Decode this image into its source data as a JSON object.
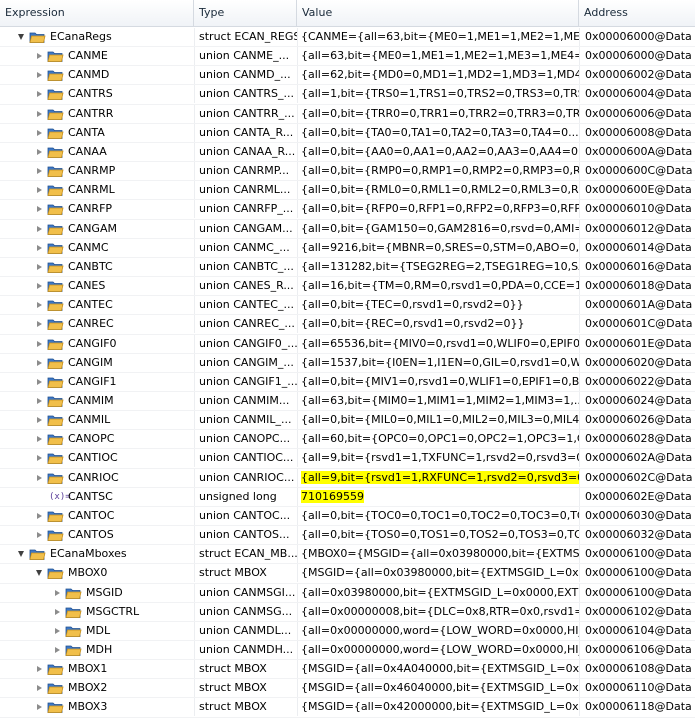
{
  "columns": {
    "expression": "Expression",
    "type": "Type",
    "value": "Value",
    "address": "Address"
  },
  "icons": {
    "struct": "struct-folder-icon",
    "variable": "variable-x-icon"
  },
  "colors": {
    "highlight": "#ffff00",
    "folder_blue": "#3c78c8",
    "folder_yellow": "#f1bf4a"
  },
  "rows": [
    {
      "level": 0,
      "tw": "expanded",
      "icon": "struct",
      "name": "ECanaRegs",
      "type": "struct ECAN_REGS",
      "value": "{CANME={all=63,bit={ME0=1,ME1=1,ME2=1,ME3...",
      "addr": "0x00006000@Data"
    },
    {
      "level": 1,
      "tw": "collapsed",
      "icon": "struct",
      "name": "CANME",
      "type": "union CANME_...",
      "value": "{all=63,bit={ME0=1,ME1=1,ME2=1,ME3=1,ME4=1...",
      "addr": "0x00006000@Data"
    },
    {
      "level": 1,
      "tw": "collapsed",
      "icon": "struct",
      "name": "CANMD",
      "type": "union CANMD_...",
      "value": "{all=62,bit={MD0=0,MD1=1,MD2=1,MD3=1,MD4=...",
      "addr": "0x00006002@Data"
    },
    {
      "level": 1,
      "tw": "collapsed",
      "icon": "struct",
      "name": "CANTRS",
      "type": "union CANTRS_...",
      "value": "{all=1,bit={TRS0=1,TRS1=0,TRS2=0,TRS3=0,TRS4=...",
      "addr": "0x00006004@Data"
    },
    {
      "level": 1,
      "tw": "collapsed",
      "icon": "struct",
      "name": "CANTRR",
      "type": "union CANTRR_...",
      "value": "{all=0,bit={TRR0=0,TRR1=0,TRR2=0,TRR3=0,TRR4...",
      "addr": "0x00006006@Data"
    },
    {
      "level": 1,
      "tw": "collapsed",
      "icon": "struct",
      "name": "CANTA",
      "type": "union CANTA_R...",
      "value": "{all=0,bit={TA0=0,TA1=0,TA2=0,TA3=0,TA4=0...}}",
      "addr": "0x00006008@Data"
    },
    {
      "level": 1,
      "tw": "collapsed",
      "icon": "struct",
      "name": "CANAA",
      "type": "union CANAA_R...",
      "value": "{all=0,bit={AA0=0,AA1=0,AA2=0,AA3=0,AA4=0...}}",
      "addr": "0x0000600A@Data"
    },
    {
      "level": 1,
      "tw": "collapsed",
      "icon": "struct",
      "name": "CANRMP",
      "type": "union CANRMP...",
      "value": "{all=0,bit={RMP0=0,RMP1=0,RMP2=0,RMP3=0,R...",
      "addr": "0x0000600C@Data"
    },
    {
      "level": 1,
      "tw": "collapsed",
      "icon": "struct",
      "name": "CANRML",
      "type": "union CANRML...",
      "value": "{all=0,bit={RML0=0,RML1=0,RML2=0,RML3=0,RM...",
      "addr": "0x0000600E@Data"
    },
    {
      "level": 1,
      "tw": "collapsed",
      "icon": "struct",
      "name": "CANRFP",
      "type": "union CANRFP_...",
      "value": "{all=0,bit={RFP0=0,RFP1=0,RFP2=0,RFP3=0,RFP4...",
      "addr": "0x00006010@Data"
    },
    {
      "level": 1,
      "tw": "collapsed",
      "icon": "struct",
      "name": "CANGAM",
      "type": "union CANGAM...",
      "value": "{all=0,bit={GAM150=0,GAM2816=0,rsvd=0,AMI=0}}",
      "addr": "0x00006012@Data"
    },
    {
      "level": 1,
      "tw": "collapsed",
      "icon": "struct",
      "name": "CANMC",
      "type": "union CANMC_...",
      "value": "{all=9216,bit={MBNR=0,SRES=0,STM=0,ABO=0,C...",
      "addr": "0x00006014@Data"
    },
    {
      "level": 1,
      "tw": "collapsed",
      "icon": "struct",
      "name": "CANBTC",
      "type": "union CANBTC_...",
      "value": "{all=131282,bit={TSEG2REG=2,TSEG1REG=10,SAM...",
      "addr": "0x00006016@Data"
    },
    {
      "level": 1,
      "tw": "collapsed",
      "icon": "struct",
      "name": "CANES",
      "type": "union CANES_R...",
      "value": "{all=16,bit={TM=0,RM=0,rsvd1=0,PDA=0,CCE=1...}",
      "addr": "0x00006018@Data"
    },
    {
      "level": 1,
      "tw": "collapsed",
      "icon": "struct",
      "name": "CANTEC",
      "type": "union CANTEC_...",
      "value": "{all=0,bit={TEC=0,rsvd1=0,rsvd2=0}}",
      "addr": "0x0000601A@Data"
    },
    {
      "level": 1,
      "tw": "collapsed",
      "icon": "struct",
      "name": "CANREC",
      "type": "union CANREC_...",
      "value": "{all=0,bit={REC=0,rsvd1=0,rsvd2=0}}",
      "addr": "0x0000601C@Data"
    },
    {
      "level": 1,
      "tw": "collapsed",
      "icon": "struct",
      "name": "CANGIF0",
      "type": "union CANGIF0_...",
      "value": "{all=65536,bit={MIV0=0,rsvd1=0,WLIF0=0,EPIF0=0,...",
      "addr": "0x0000601E@Data"
    },
    {
      "level": 1,
      "tw": "collapsed",
      "icon": "struct",
      "name": "CANGIM",
      "type": "union CANGIM_...",
      "value": "{all=1537,bit={I0EN=1,I1EN=0,GIL=0,rsvd1=0,WL...",
      "addr": "0x00006020@Data"
    },
    {
      "level": 1,
      "tw": "collapsed",
      "icon": "struct",
      "name": "CANGIF1",
      "type": "union CANGIF1_...",
      "value": "{all=0,bit={MIV1=0,rsvd1=0,WLIF1=0,EPIF1=0,BOI...",
      "addr": "0x00006022@Data"
    },
    {
      "level": 1,
      "tw": "collapsed",
      "icon": "struct",
      "name": "CANMIM",
      "type": "union CANMIM...",
      "value": "{all=63,bit={MIM0=1,MIM1=1,MIM2=1,MIM3=1,...",
      "addr": "0x00006024@Data"
    },
    {
      "level": 1,
      "tw": "collapsed",
      "icon": "struct",
      "name": "CANMIL",
      "type": "union CANMIL_...",
      "value": "{all=0,bit={MIL0=0,MIL1=0,MIL2=0,MIL3=0,MIL4=...",
      "addr": "0x00006026@Data"
    },
    {
      "level": 1,
      "tw": "collapsed",
      "icon": "struct",
      "name": "CANOPC",
      "type": "union CANOPC...",
      "value": "{all=60,bit={OPC0=0,OPC1=0,OPC2=1,OPC3=1,O...",
      "addr": "0x00006028@Data"
    },
    {
      "level": 1,
      "tw": "collapsed",
      "icon": "struct",
      "name": "CANTIOC",
      "type": "union CANTIOC...",
      "value": "{all=9,bit={rsvd1=1,TXFUNC=1,rsvd2=0,rsvd3=0}}",
      "addr": "0x0000602A@Data"
    },
    {
      "level": 1,
      "tw": "collapsed",
      "icon": "struct",
      "name": "CANRIOC",
      "type": "union CANRIOC...",
      "value": "{all=9,bit={rsvd1=1,RXFUNC=1,rsvd2=0,rsvd3=0}}",
      "addr": "0x0000602C@Data",
      "hl": true
    },
    {
      "level": 1,
      "tw": "none",
      "icon": "variable",
      "name": "CANTSC",
      "type": "unsigned long",
      "value": "710169559",
      "addr": "0x0000602E@Data",
      "hl": true
    },
    {
      "level": 1,
      "tw": "collapsed",
      "icon": "struct",
      "name": "CANTOC",
      "type": "union CANTOC...",
      "value": "{all=0,bit={TOC0=0,TOC1=0,TOC2=0,TOC3=0,TO...",
      "addr": "0x00006030@Data"
    },
    {
      "level": 1,
      "tw": "collapsed",
      "icon": "struct",
      "name": "CANTOS",
      "type": "union CANTOS...",
      "value": "{all=0,bit={TOS0=0,TOS1=0,TOS2=0,TOS3=0,TOS...",
      "addr": "0x00006032@Data"
    },
    {
      "level": 0,
      "tw": "expanded",
      "icon": "struct",
      "name": "ECanaMboxes",
      "type": "struct ECAN_MB...",
      "value": "{MBOX0={MSGID={all=0x03980000,bit={EXTMSGI...",
      "addr": "0x00006100@Data"
    },
    {
      "level": 1,
      "tw": "expanded",
      "icon": "struct",
      "name": "MBOX0",
      "type": "struct MBOX",
      "value": "{MSGID={all=0x03980000,bit={EXTMSGID_L=0x000...",
      "addr": "0x00006100@Data"
    },
    {
      "level": 2,
      "tw": "collapsed",
      "icon": "struct",
      "name": "MSGID",
      "type": "union CANMSGI...",
      "value": "{all=0x03980000,bit={EXTMSGID_L=0x0000,EXTMS...",
      "addr": "0x00006100@Data"
    },
    {
      "level": 2,
      "tw": "collapsed",
      "icon": "struct",
      "name": "MSGCTRL",
      "type": "union CANMSG...",
      "value": "{all=0x00000008,bit={DLC=0x8,RTR=0x0,rsvd1=0x0...",
      "addr": "0x00006102@Data"
    },
    {
      "level": 2,
      "tw": "collapsed",
      "icon": "struct",
      "name": "MDL",
      "type": "union CANMDL...",
      "value": "{all=0x00000000,word={LOW_WORD=0x0000,HI_W...",
      "addr": "0x00006104@Data"
    },
    {
      "level": 2,
      "tw": "collapsed",
      "icon": "struct",
      "name": "MDH",
      "type": "union CANMDH...",
      "value": "{all=0x00000000,word={LOW_WORD=0x0000,HI_W...",
      "addr": "0x00006106@Data"
    },
    {
      "level": 1,
      "tw": "collapsed",
      "icon": "struct",
      "name": "MBOX1",
      "type": "struct MBOX",
      "value": "{MSGID={all=0x4A040000,bit={EXTMSGID_L=0x000...",
      "addr": "0x00006108@Data"
    },
    {
      "level": 1,
      "tw": "collapsed",
      "icon": "struct",
      "name": "MBOX2",
      "type": "struct MBOX",
      "value": "{MSGID={all=0x46040000,bit={EXTMSGID_L=0x000...",
      "addr": "0x00006110@Data"
    },
    {
      "level": 1,
      "tw": "collapsed",
      "icon": "struct",
      "name": "MBOX3",
      "type": "struct MBOX",
      "value": "{MSGID={all=0x42000000,bit={EXTMSGID_L=0x000...",
      "addr": "0x00006118@Data"
    }
  ]
}
